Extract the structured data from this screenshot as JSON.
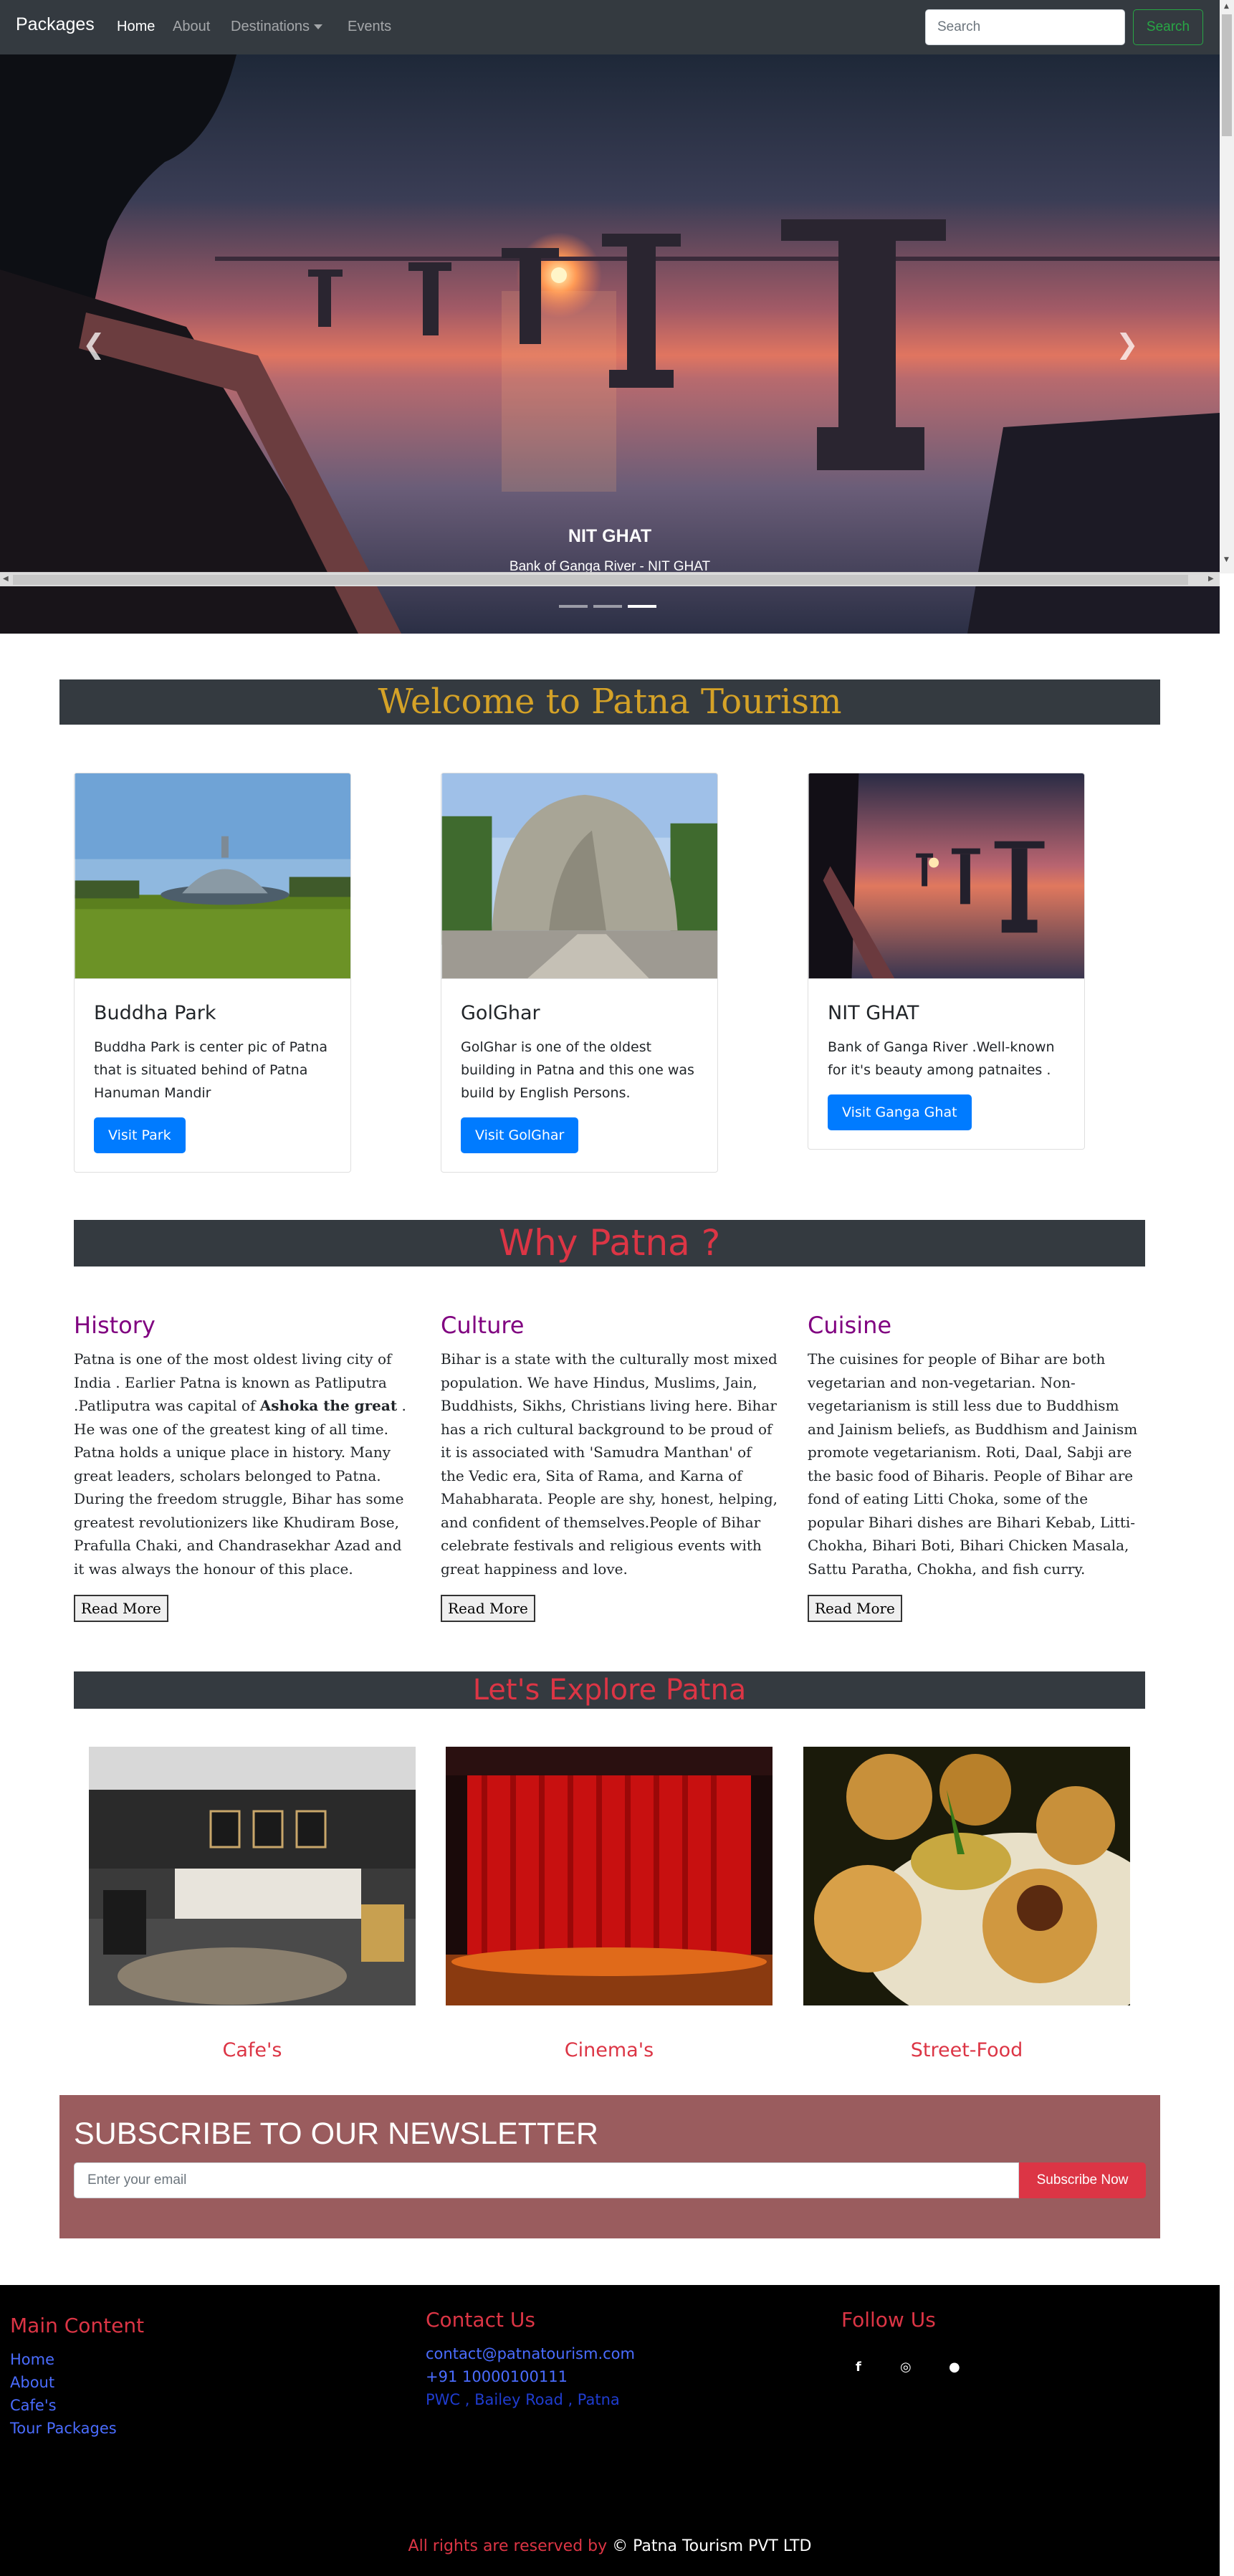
{
  "navbar": {
    "brand": "Packages",
    "links": [
      "Home",
      "About",
      "Destinations",
      "Events"
    ],
    "search_placeholder": "Search",
    "search_button": "Search"
  },
  "carousel": {
    "caption_title": "NIT GHAT",
    "caption_text": "Bank of Ganga River - NIT GHAT",
    "prev_icon": "chevron-left-icon",
    "next_icon": "chevron-right-icon",
    "indicator_count": 3,
    "active_indicator": 3
  },
  "welcome": {
    "title": "Welcome to Patna Tourism"
  },
  "cards": [
    {
      "title": "Buddha Park",
      "text": "Buddha Park is center pic of Patna that is situated behind of Patna Hanuman Mandir",
      "button": "Visit Park"
    },
    {
      "title": "GolGhar",
      "text": "GolGhar is one of the oldest building in Patna and this one was build by English Persons.",
      "button": "Visit GolGhar"
    },
    {
      "title": "NIT GHAT",
      "text": "Bank of Ganga River .Well-known for it's beauty among patnaites .",
      "button": "Visit Ganga Ghat"
    }
  ],
  "why": {
    "title": "Why Patna ?",
    "columns": [
      {
        "heading": "History",
        "text_before": "Patna is one of the most oldest living city of India . Earlier Patna is known as Patliputra .Patliputra was capital of ",
        "bold": "Ashoka the great",
        "text_after": " . He was one of the greatest king of all time. Patna holds a unique place in history. Many great leaders, scholars belonged to Patna. During the freedom struggle, Bihar has some greatest revolutionizers like Khudiram Bose, Prafulla Chaki, and Chandrasekhar Azad and it was always the honour of this place.",
        "button": "Read More"
      },
      {
        "heading": "Culture",
        "text": "Bihar is a state with the culturally most mixed population. We have Hindus, Muslims, Jain, Buddhists, Sikhs, Christians living here. Bihar has a rich cultural background to be proud of it is associated with 'Samudra Manthan' of the Vedic era, Sita of Rama, and Karna of Mahabharata. People are shy, honest, helping, and confident of themselves.People of Bihar celebrate festivals and religious events with great happiness and love.",
        "button": "Read More"
      },
      {
        "heading": "Cuisine",
        "text": "The cuisines for people of Bihar are both vegetarian and non-vegetarian. Non-vegetarianism is still less due to Buddhism and Jainism beliefs, as Buddhism and Jainism promote vegetarianism. Roti, Daal, Sabji are the basic food of Biharis. People of Bihar are fond of eating Litti Choka, some of the popular Bihari dishes are Bihari Kebab, Litti-Chokha, Bihari Boti, Bihari Chicken Masala, Sattu Paratha, Chokha, and fish curry.",
        "button": "Read More"
      }
    ]
  },
  "explore": {
    "title": "Let's Explore Patna",
    "items": [
      "Cafe's",
      "Cinema's",
      "Street-Food"
    ]
  },
  "newsletter": {
    "title": "SUBSCRIBE TO OUR NEWSLETTER",
    "placeholder": "Enter your email",
    "button": "Subscribe Now"
  },
  "footer": {
    "main_heading": "Main Content",
    "main_links": [
      "Home",
      "About",
      "Cafe's",
      "Tour Packages"
    ],
    "contact_heading": "Contact Us",
    "contact_email": "contact@patnatourism.com",
    "contact_phone": "+91 10000100111",
    "contact_address": "PWC , Bailey Road , Patna",
    "follow_heading": "Follow Us",
    "social_icons": [
      "facebook-icon",
      "instagram-icon",
      "snapchat-icon"
    ],
    "copyright_prefix": "All rights are reserved by",
    "copyright_owner": "© Patna Tourism PVT LTD"
  },
  "colors": {
    "navbar": "#343a40",
    "welcome_text": "#d5a227",
    "accent_red": "#dc3545",
    "heading_purple": "#800080",
    "primary_blue": "#007bff",
    "newsletter_bg": "#9a5c5e",
    "footer_bg": "#000000"
  }
}
